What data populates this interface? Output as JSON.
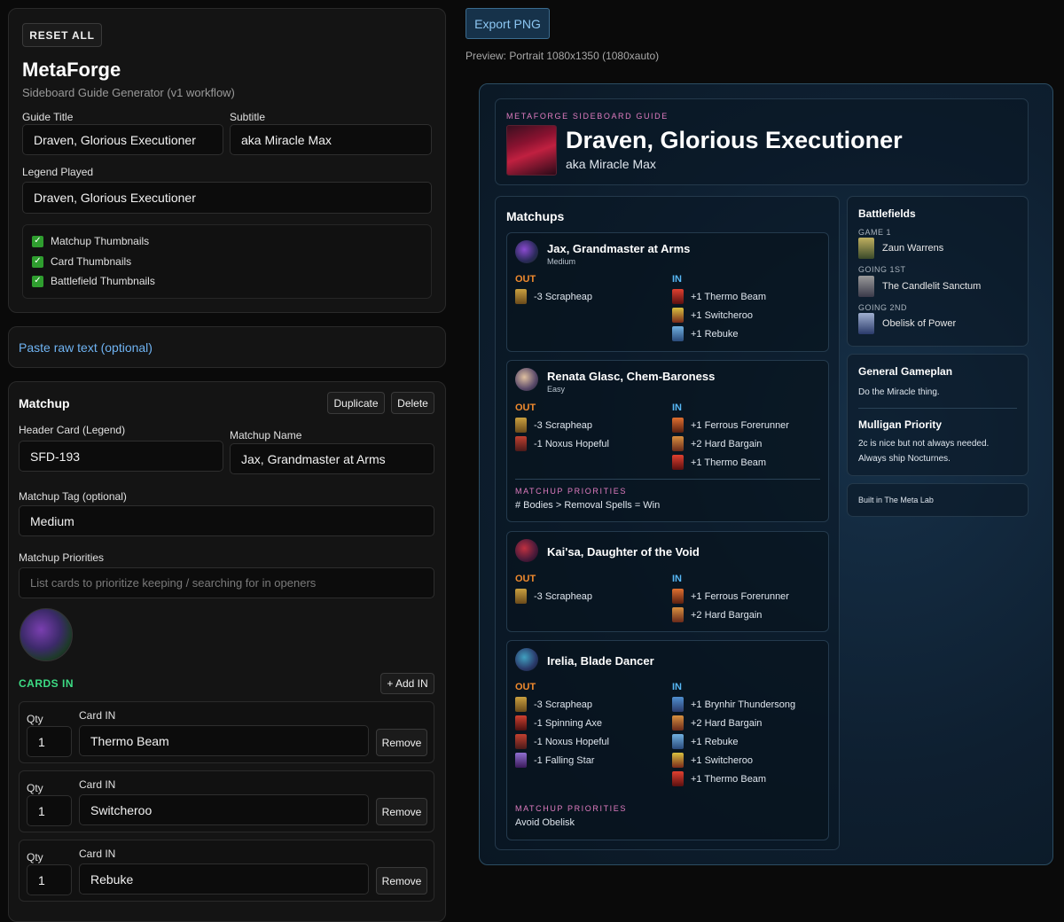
{
  "editor": {
    "reset_label": "RESET ALL",
    "app_title": "MetaForge",
    "app_subtitle": "Sideboard Guide Generator (v1 workflow)",
    "guide_title_label": "Guide Title",
    "guide_title_value": "Draven, Glorious Executioner",
    "subtitle_label": "Subtitle",
    "subtitle_value": "aka Miracle Max",
    "legend_label": "Legend Played",
    "legend_value": "Draven, Glorious Executioner",
    "toggles": [
      "Matchup Thumbnails",
      "Card Thumbnails",
      "Battlefield Thumbnails"
    ],
    "paste_label": "Paste raw text (optional)",
    "matchup": {
      "section_title": "Matchup",
      "duplicate_label": "Duplicate",
      "delete_label": "Delete",
      "header_card_label": "Header Card (Legend)",
      "header_card_value": "SFD-193",
      "name_label": "Matchup Name",
      "name_value": "Jax, Grandmaster at Arms",
      "tag_label": "Matchup Tag (optional)",
      "tag_value": "Medium",
      "priorities_label": "Matchup Priorities",
      "priorities_placeholder": "List cards to prioritize keeping / searching for in openers",
      "cards_in_title": "CARDS IN",
      "add_in_label": "+ Add IN",
      "qty_label": "Qty",
      "card_in_label": "Card IN",
      "remove_label": "Remove",
      "cards_in": [
        {
          "qty": "1",
          "name": "Thermo Beam"
        },
        {
          "qty": "1",
          "name": "Switcheroo"
        },
        {
          "qty": "1",
          "name": "Rebuke"
        }
      ]
    }
  },
  "preview": {
    "export_label": "Export PNG",
    "preview_caption": "Preview: Portrait 1080x1350 (1080xauto)",
    "kicker": "METAFORGE SIDEBOARD GUIDE",
    "title": "Draven, Glorious Executioner",
    "subtitle": "aka Miracle Max",
    "matchups_title": "Matchups",
    "out_label": "OUT",
    "in_label": "IN",
    "priorities_label": "MATCHUP PRIORITIES",
    "matchups": [
      {
        "name": "Jax, Grandmaster at Arms",
        "tag": "Medium",
        "out": [
          "-3 Scrapheap"
        ],
        "in": [
          "+1 Thermo Beam",
          "+1 Switcheroo",
          "+1 Rebuke"
        ],
        "priorities": ""
      },
      {
        "name": "Renata Glasc, Chem-Baroness",
        "tag": "Easy",
        "out": [
          "-3 Scrapheap",
          "-1 Noxus Hopeful"
        ],
        "in": [
          "+1 Ferrous Forerunner",
          "+2 Hard Bargain",
          "+1 Thermo Beam"
        ],
        "priorities": "# Bodies > Removal Spells = Win"
      },
      {
        "name": "Kai'sa, Daughter of the Void",
        "tag": "",
        "out": [
          "-3 Scrapheap"
        ],
        "in": [
          "+1 Ferrous Forerunner",
          "+2 Hard Bargain"
        ],
        "priorities": ""
      },
      {
        "name": "Irelia, Blade Dancer",
        "tag": "",
        "out": [
          "-3 Scrapheap",
          "-1 Spinning Axe",
          "-1 Noxus Hopeful",
          "-1 Falling Star"
        ],
        "in": [
          "+1 Brynhir Thundersong",
          "+2 Hard Bargain",
          "+1 Rebuke",
          "+1 Switcheroo",
          "+1 Thermo Beam"
        ],
        "priorities": "Avoid Obelisk"
      }
    ],
    "battlefields_title": "Battlefields",
    "battlefields": [
      {
        "caption": "GAME 1",
        "name": "Zaun Warrens"
      },
      {
        "caption": "GOING 1ST",
        "name": "The Candlelit Sanctum"
      },
      {
        "caption": "GOING 2ND",
        "name": "Obelisk of Power"
      }
    ],
    "gameplan_title": "General Gameplan",
    "gameplan_text": "Do the Miracle thing.",
    "mulligan_title": "Mulligan Priority",
    "mulligan_lines": [
      "2c is nice but not always needed.",
      "Always ship Nocturnes."
    ],
    "footer": "Built in The Meta Lab"
  },
  "colors": {
    "accent_out": "#f08a2e",
    "accent_in": "#57b7f5",
    "kicker": "#e07cc0",
    "cards_in": "#3ddc84"
  }
}
